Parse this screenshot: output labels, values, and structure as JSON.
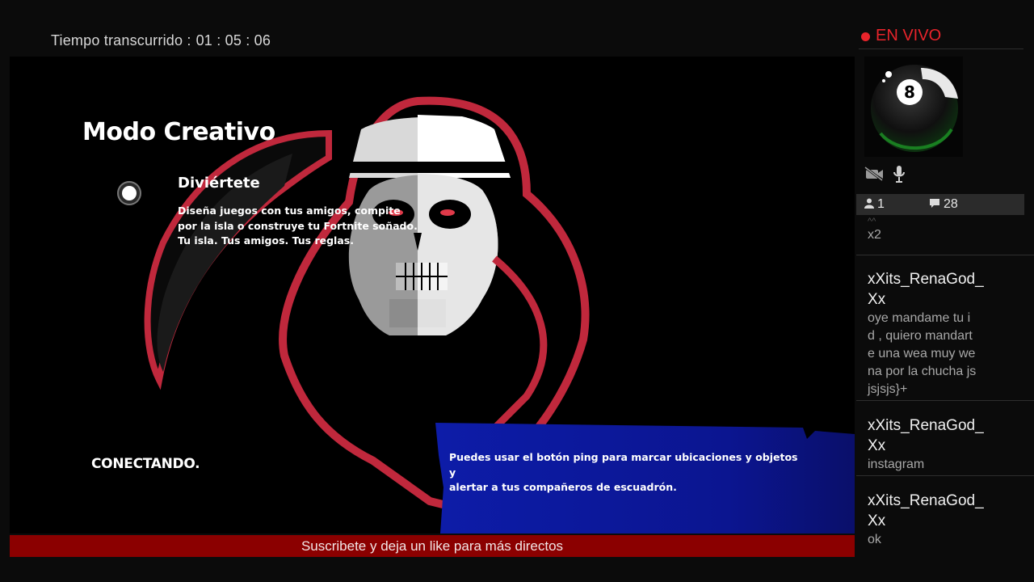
{
  "stream": {
    "elapsed_label": "Tiempo transcurrido :",
    "elapsed_value": "01 : 05 : 06"
  },
  "game": {
    "mode_title": "Modo Creativo",
    "option_title": "Diviértete",
    "option_desc_lines": [
      "Diseña juegos con tus amigos, compite",
      "por la isla o construye tu Fortnite soñado.",
      "Tu isla. Tus amigos. Tus reglas."
    ],
    "status": "CONECTANDO.",
    "tip_lines": [
      "Puedes usar el botón ping para marcar ubicaciones y objetos y",
      "alertar a tus compañeros de escuadrón."
    ]
  },
  "banner": "Suscribete y deja un like para más directos",
  "side": {
    "live_label": "EN VIVO",
    "live_color": "#e8242b",
    "avatar_number": "8",
    "icons": [
      "camera-off-icon",
      "microphone-icon",
      "viewer-icon",
      "comment-icon"
    ],
    "viewers": "1",
    "comments": "28"
  },
  "chat": {
    "partial_faded": "^^",
    "partial_body": "x2",
    "messages": [
      {
        "user_lines": [
          "xXits_RenaGod_",
          "Xx"
        ],
        "body_lines": [
          "oye mandame tu i",
          "d , quiero mandart",
          "e una wea muy we",
          "na por la chucha js",
          "jsjsjs}+"
        ]
      },
      {
        "user_lines": [
          "xXits_RenaGod_",
          "Xx"
        ],
        "body_lines": [
          "instagram"
        ]
      },
      {
        "user_lines": [
          "xXits_RenaGod_",
          "Xx"
        ],
        "body_lines": [
          "ok"
        ]
      }
    ]
  }
}
